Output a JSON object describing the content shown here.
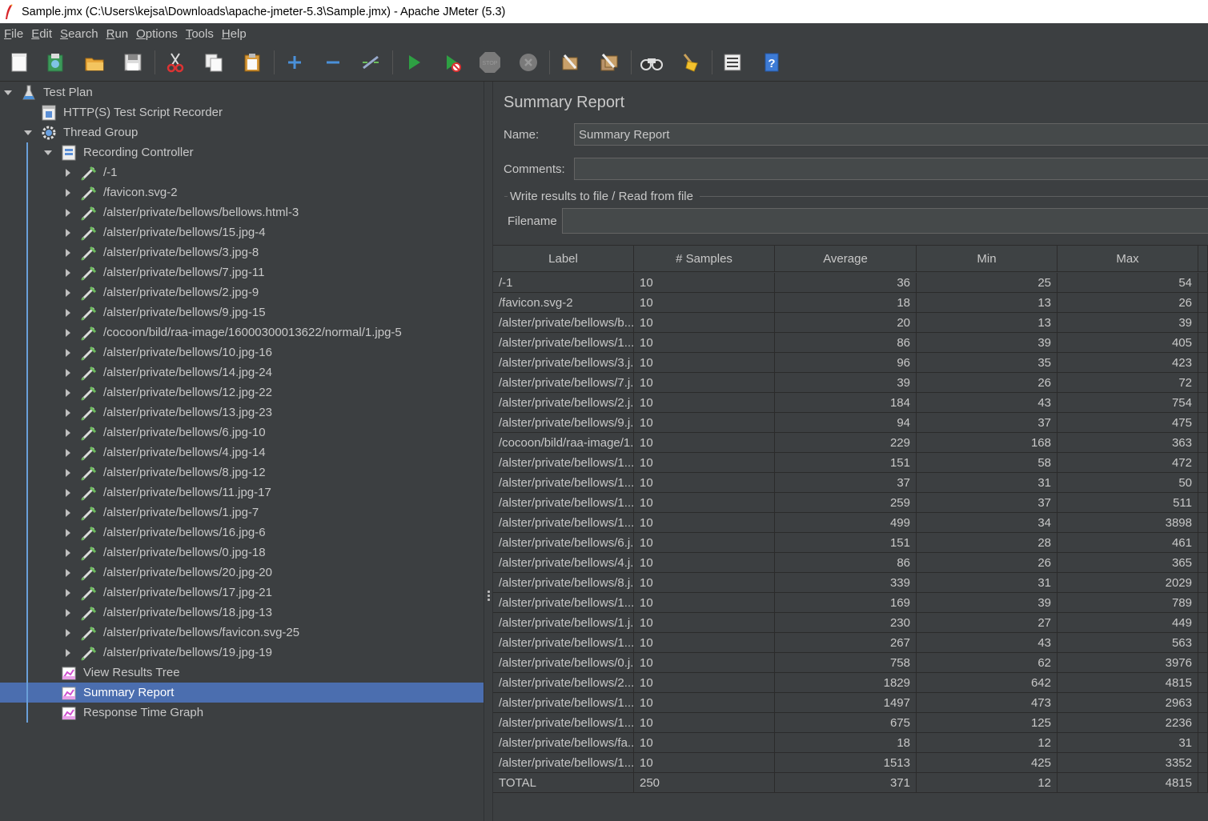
{
  "window": {
    "title": "Sample.jmx (C:\\Users\\kejsa\\Downloads\\apache-jmeter-5.3\\Sample.jmx) - Apache JMeter (5.3)"
  },
  "menu": [
    {
      "label": "File",
      "key": "F",
      "rest": "ile"
    },
    {
      "label": "Edit",
      "key": "E",
      "rest": "dit"
    },
    {
      "label": "Search",
      "key": "S",
      "rest": "earch"
    },
    {
      "label": "Run",
      "key": "R",
      "rest": "un"
    },
    {
      "label": "Options",
      "key": "O",
      "rest": "ptions"
    },
    {
      "label": "Tools",
      "key": "T",
      "rest": "ools"
    },
    {
      "label": "Help",
      "key": "H",
      "rest": "elp"
    }
  ],
  "toolbar": {
    "icons": [
      "new-icon",
      "templates-icon",
      "open-icon",
      "save-icon",
      "cut-icon",
      "copy-icon",
      "paste-icon",
      "expand-icon",
      "collapse-icon",
      "toggle-icon",
      "start-icon",
      "start-no-pauses-icon",
      "stop-icon",
      "shutdown-icon",
      "clear-icon",
      "clear-all-icon",
      "search-icon",
      "reset-search-icon",
      "function-helper-icon",
      "help-icon"
    ]
  },
  "tree": {
    "test_plan": "Test Plan",
    "recorder": "HTTP(S) Test Script Recorder",
    "thread_group": "Thread Group",
    "recording_controller": "Recording Controller",
    "samplers": [
      "/-1",
      "/favicon.svg-2",
      "/alster/private/bellows/bellows.html-3",
      "/alster/private/bellows/15.jpg-4",
      "/alster/private/bellows/3.jpg-8",
      "/alster/private/bellows/7.jpg-11",
      "/alster/private/bellows/2.jpg-9",
      "/alster/private/bellows/9.jpg-15",
      "/cocoon/bild/raa-image/16000300013622/normal/1.jpg-5",
      "/alster/private/bellows/10.jpg-16",
      "/alster/private/bellows/14.jpg-24",
      "/alster/private/bellows/12.jpg-22",
      "/alster/private/bellows/13.jpg-23",
      "/alster/private/bellows/6.jpg-10",
      "/alster/private/bellows/4.jpg-14",
      "/alster/private/bellows/8.jpg-12",
      "/alster/private/bellows/11.jpg-17",
      "/alster/private/bellows/1.jpg-7",
      "/alster/private/bellows/16.jpg-6",
      "/alster/private/bellows/0.jpg-18",
      "/alster/private/bellows/20.jpg-20",
      "/alster/private/bellows/17.jpg-21",
      "/alster/private/bellows/18.jpg-13",
      "/alster/private/bellows/favicon.svg-25",
      "/alster/private/bellows/19.jpg-19"
    ],
    "listeners": [
      "View Results Tree",
      "Summary Report",
      "Response Time Graph"
    ],
    "selected": "Summary Report"
  },
  "panel": {
    "title": "Summary Report",
    "name_label": "Name:",
    "name_value": "Summary Report",
    "comments_label": "Comments:",
    "comments_value": "",
    "file_legend": "Write results to file / Read from file",
    "filename_label": "Filename",
    "filename_value": ""
  },
  "table": {
    "columns": [
      "Label",
      "# Samples",
      "Average",
      "Min",
      "Max"
    ],
    "rows": [
      [
        "/-1",
        "10",
        "36",
        "25",
        "54"
      ],
      [
        "/favicon.svg-2",
        "10",
        "18",
        "13",
        "26"
      ],
      [
        "/alster/private/bellows/b...",
        "10",
        "20",
        "13",
        "39"
      ],
      [
        "/alster/private/bellows/1...",
        "10",
        "86",
        "39",
        "405"
      ],
      [
        "/alster/private/bellows/3.j...",
        "10",
        "96",
        "35",
        "423"
      ],
      [
        "/alster/private/bellows/7.j...",
        "10",
        "39",
        "26",
        "72"
      ],
      [
        "/alster/private/bellows/2.j...",
        "10",
        "184",
        "43",
        "754"
      ],
      [
        "/alster/private/bellows/9.j...",
        "10",
        "94",
        "37",
        "475"
      ],
      [
        "/cocoon/bild/raa-image/1...",
        "10",
        "229",
        "168",
        "363"
      ],
      [
        "/alster/private/bellows/1...",
        "10",
        "151",
        "58",
        "472"
      ],
      [
        "/alster/private/bellows/1...",
        "10",
        "37",
        "31",
        "50"
      ],
      [
        "/alster/private/bellows/1...",
        "10",
        "259",
        "37",
        "511"
      ],
      [
        "/alster/private/bellows/1...",
        "10",
        "499",
        "34",
        "3898"
      ],
      [
        "/alster/private/bellows/6.j...",
        "10",
        "151",
        "28",
        "461"
      ],
      [
        "/alster/private/bellows/4.j...",
        "10",
        "86",
        "26",
        "365"
      ],
      [
        "/alster/private/bellows/8.j...",
        "10",
        "339",
        "31",
        "2029"
      ],
      [
        "/alster/private/bellows/1...",
        "10",
        "169",
        "39",
        "789"
      ],
      [
        "/alster/private/bellows/1.j...",
        "10",
        "230",
        "27",
        "449"
      ],
      [
        "/alster/private/bellows/1...",
        "10",
        "267",
        "43",
        "563"
      ],
      [
        "/alster/private/bellows/0.j...",
        "10",
        "758",
        "62",
        "3976"
      ],
      [
        "/alster/private/bellows/2...",
        "10",
        "1829",
        "642",
        "4815"
      ],
      [
        "/alster/private/bellows/1...",
        "10",
        "1497",
        "473",
        "2963"
      ],
      [
        "/alster/private/bellows/1...",
        "10",
        "675",
        "125",
        "2236"
      ],
      [
        "/alster/private/bellows/fa...",
        "10",
        "18",
        "12",
        "31"
      ],
      [
        "/alster/private/bellows/1...",
        "10",
        "1513",
        "425",
        "3352"
      ],
      [
        "TOTAL",
        "250",
        "371",
        "12",
        "4815"
      ]
    ]
  }
}
